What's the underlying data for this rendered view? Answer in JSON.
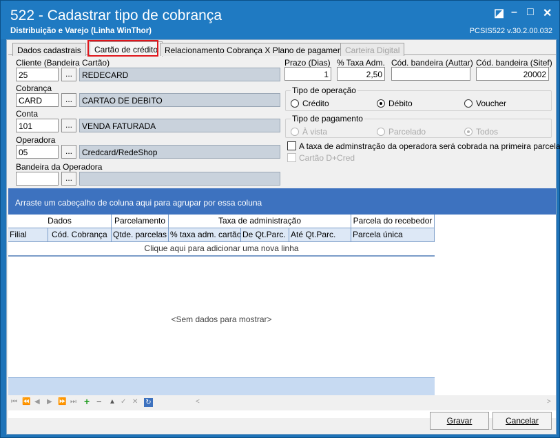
{
  "window": {
    "title": "522 - Cadastrar tipo de cobrança",
    "subtitle": "Distribuição e Varejo (Linha WinThor)",
    "version": "PCSIS522  v.30.2.00.032",
    "controls": {
      "restore": "◪",
      "minimize": "–",
      "maximize": "□",
      "close": "✕"
    }
  },
  "tabs": [
    {
      "label": "Dados cadastrais"
    },
    {
      "label": "Cartão de crédito"
    },
    {
      "label": "Relacionamento Cobrança X Plano de pagamento"
    },
    {
      "label": "Carteira Digital"
    }
  ],
  "form": {
    "cliente": {
      "label": "Cliente (Bandeira Cartão)",
      "code": "25",
      "desc": "REDECARD"
    },
    "cobranca": {
      "label": "Cobrança",
      "code": "CARD",
      "desc": "CARTAO DE DEBITO"
    },
    "conta": {
      "label": "Conta",
      "code": "101",
      "desc": "VENDA FATURADA"
    },
    "operadora": {
      "label": "Operadora",
      "code": "05",
      "desc": "Credcard/RedeShop"
    },
    "bandeira_operadora": {
      "label": "Bandeira da Operadora",
      "code": "",
      "desc": ""
    },
    "lookup_button": "...",
    "prazo": {
      "label": "Prazo (Dias)",
      "value": "1"
    },
    "taxa_adm": {
      "label": "% Taxa Adm.",
      "value": "2,50"
    },
    "cod_bandeira_auttar": {
      "label": "Cód. bandeira (Auttar)",
      "value": ""
    },
    "cod_bandeira_sitef": {
      "label": "Cód. bandeira (Sitef)",
      "value": "20002"
    },
    "tipo_operacao": {
      "title": "Tipo de operação",
      "options": [
        "Crédito",
        "Débito",
        "Voucher"
      ],
      "selected": "Débito"
    },
    "tipo_pagamento": {
      "title": "Tipo de pagamento",
      "options": [
        "À vista",
        "Parcelado",
        "Todos"
      ],
      "selected": "Todos"
    },
    "taxa_primeira_parcela": {
      "label": "A taxa de adminstração da operadora será cobrada na primeira parcela",
      "checked": false
    },
    "cartao_d_cred": {
      "label": "Cartão D+Cred",
      "checked": false
    }
  },
  "grid": {
    "group_hint": "Arraste um cabeçalho de coluna aqui para agrupar por essa coluna",
    "bands": [
      "Dados",
      "Parcelamento",
      "Taxa de administração",
      "Parcela do recebedor"
    ],
    "columns": [
      "Filial",
      "Cód. Cobrança",
      "Qtde. parcelas",
      "% taxa adm. cartão",
      "De Qt.Parc.",
      "Até Qt.Parc.",
      "Parcela única"
    ],
    "new_row_hint": "Clique aqui para adicionar uma nova linha",
    "empty_text": "<Sem dados para mostrar>"
  },
  "navigator": {
    "first": "⏮",
    "prev_page": "⏪",
    "prev": "◀",
    "next": "▶",
    "next_page": "⏩",
    "last": "⏭",
    "insert": "+",
    "delete": "−",
    "edit": "▲",
    "post": "✓",
    "cancel": "✕",
    "refresh": "↻",
    "scroll_left": "<",
    "scroll_right": ">"
  },
  "buttons": {
    "save": "Gravar",
    "cancel": "Cancelar"
  }
}
